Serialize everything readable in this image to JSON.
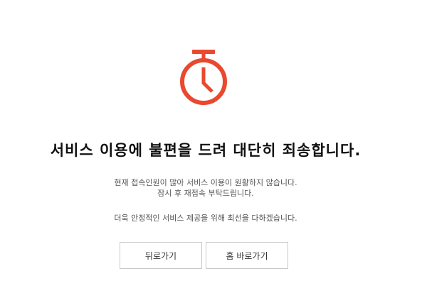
{
  "error": {
    "icon": "stopwatch-icon",
    "accent_color": "#e8492f",
    "title": "서비스 이용에 불편을 드려 대단히 죄송합니다.",
    "message_line1": "현재 접속인원이 많아 서비스 이용이 원활하지 않습니다.",
    "message_line2": "잠시 후 재접속 부탁드립니다.",
    "message_line3": "더욱 안정적인 서비스 제공을 위해 최선을 다하겠습니다."
  },
  "buttons": {
    "back_label": "뒤로가기",
    "home_label": "홈 바로가기"
  }
}
